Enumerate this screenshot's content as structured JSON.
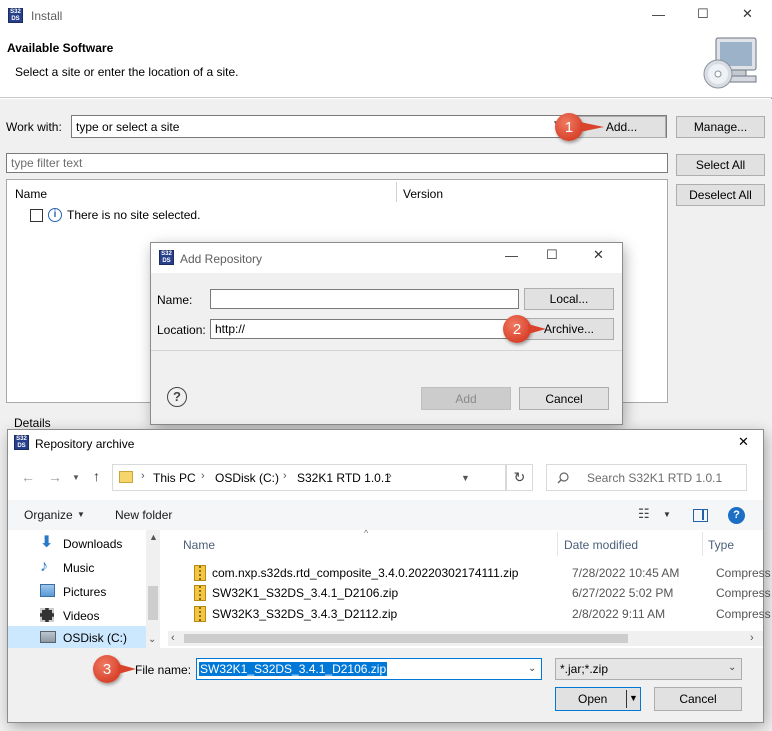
{
  "install": {
    "title": "Install",
    "heading": "Available Software",
    "subtitle": "Select a site or enter the location of a site.",
    "work_with_label": "Work with:",
    "work_with_placeholder": "type or select a site",
    "add_button": "Add...",
    "manage_button": "Manage...",
    "filter_placeholder": "type filter text",
    "select_all": "Select All",
    "deselect_all": "Deselect All",
    "col_name": "Name",
    "col_version": "Version",
    "no_site": "There is no site selected.",
    "details_label": "Details"
  },
  "add_repo": {
    "title": "Add Repository",
    "name_label": "Name:",
    "name_value": "",
    "location_label": "Location:",
    "location_value": "http://",
    "local_button": "Local...",
    "archive_button": "Archive...",
    "add_button": "Add",
    "cancel_button": "Cancel"
  },
  "archive": {
    "title": "Repository archive",
    "breadcrumb": [
      "This PC",
      "OSDisk (C:)",
      "S32K1 RTD 1.0.1"
    ],
    "search_placeholder": "Search S32K1 RTD 1.0.1",
    "organize": "Organize",
    "new_folder": "New folder",
    "nav_items": [
      {
        "label": "Downloads",
        "icon": "download-icon"
      },
      {
        "label": "Music",
        "icon": "music-icon"
      },
      {
        "label": "Pictures",
        "icon": "pictures-icon"
      },
      {
        "label": "Videos",
        "icon": "videos-icon"
      },
      {
        "label": "OSDisk (C:)",
        "icon": "drive-icon"
      }
    ],
    "columns": {
      "name": "Name",
      "date": "Date modified",
      "type": "Type"
    },
    "files": [
      {
        "name": "com.nxp.s32ds.rtd_composite_3.4.0.20220302174111.zip",
        "date": "7/28/2022 10:45 AM",
        "type": "Compress"
      },
      {
        "name": "SW32K1_S32DS_3.4.1_D2106.zip",
        "date": "6/27/2022 5:02 PM",
        "type": "Compress"
      },
      {
        "name": "SW32K3_S32DS_3.4.3_D2112.zip",
        "date": "2/8/2022 9:11 AM",
        "type": "Compress"
      }
    ],
    "file_name_label": "File name:",
    "file_name_value": "SW32K1_S32DS_3.4.1_D2106.zip",
    "filter_value": "*.jar;*.zip",
    "open_button": "Open",
    "cancel_button": "Cancel"
  },
  "callouts": [
    "1",
    "2",
    "3"
  ],
  "colors": {
    "callout": "#d9432c",
    "selection": "#0078d7",
    "help": "#1c6fc4"
  }
}
